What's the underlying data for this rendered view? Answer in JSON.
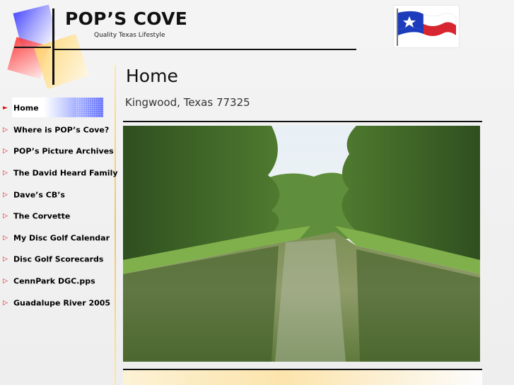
{
  "site": {
    "title": "POP’S COVE",
    "tagline": "Quality Texas Lifestyle"
  },
  "nav": {
    "items": [
      {
        "label": "Home",
        "active": true
      },
      {
        "label": "Where is POP’s Cove?",
        "active": false
      },
      {
        "label": "POP’s Picture Archives",
        "active": false
      },
      {
        "label": "The David Heard Family",
        "active": false
      },
      {
        "label": "Dave’s CB’s",
        "active": false
      },
      {
        "label": "The Corvette",
        "active": false
      },
      {
        "label": "My Disc Golf Calendar",
        "active": false
      },
      {
        "label": "Disc Golf Scorecards",
        "active": false
      },
      {
        "label": "CennPark DGC.pps",
        "active": false
      },
      {
        "label": "Guadalupe River 2005",
        "active": false
      }
    ],
    "arrow_active": "►",
    "arrow_inactive": "▷"
  },
  "main": {
    "title": "Home",
    "subtitle": "Kingwood, Texas 77325"
  },
  "colors": {
    "text": "#111111",
    "nav_arrow": "#dd1111",
    "divider": "#f2c36b",
    "nav_active_accent": "#5a66ff"
  },
  "icons": {
    "flag": "texas-flag-icon",
    "logo": "collage-logo-icon"
  }
}
